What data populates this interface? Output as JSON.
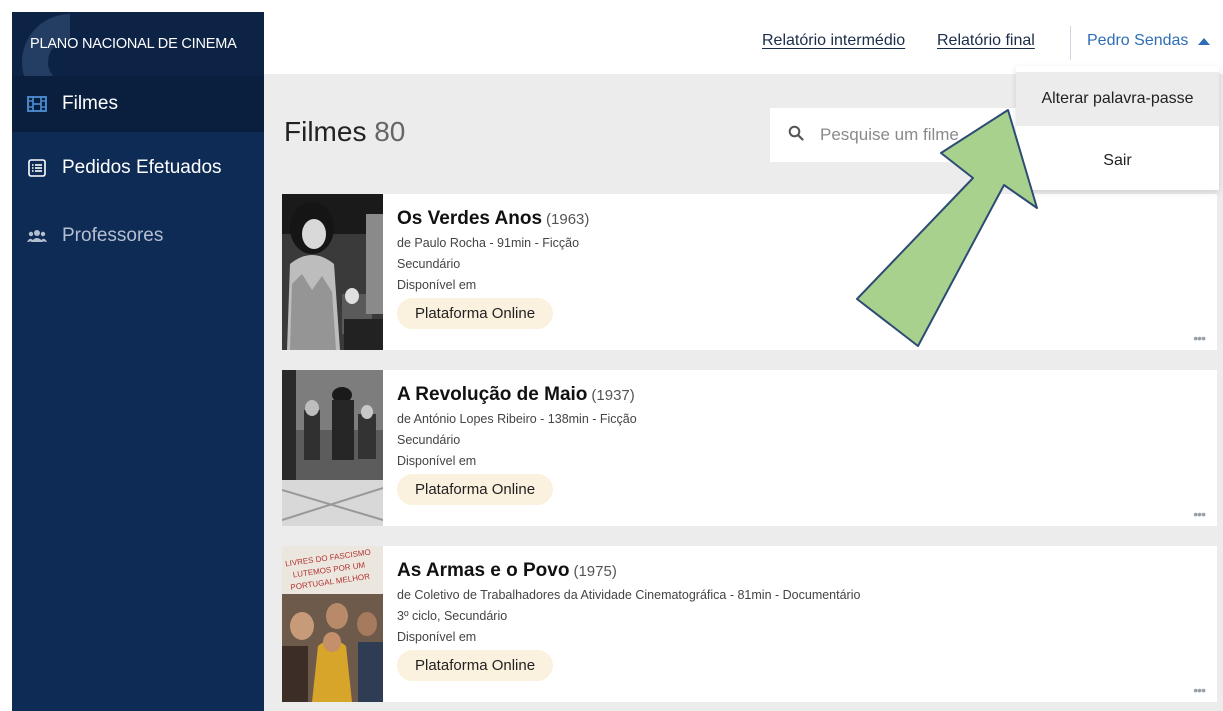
{
  "brand": {
    "logo_text": "PLANO NACIONAL DE CINEMA"
  },
  "sidebar": {
    "items": [
      {
        "label": "Filmes",
        "icon": "film-icon",
        "active": true
      },
      {
        "label": "Pedidos Efetuados",
        "icon": "list-icon",
        "active": false
      },
      {
        "label": "Professores",
        "icon": "users-icon",
        "active": false
      }
    ]
  },
  "topbar": {
    "link_intermediate": "Relatório intermédio",
    "link_final": "Relatório final",
    "user_name": "Pedro Sendas"
  },
  "user_dropdown": {
    "items": [
      "Alterar palavra-passe",
      "Sair"
    ]
  },
  "main": {
    "title": "Filmes",
    "count": "80",
    "search_placeholder": "Pesquise um filme"
  },
  "films": [
    {
      "title": "Os Verdes Anos",
      "year": "(1963)",
      "meta": "de Paulo Rocha - 91min - Ficção",
      "level": "Secundário",
      "available_label": "Disponível em",
      "platform": "Plataforma Online"
    },
    {
      "title": "A Revolução de Maio",
      "year": "(1937)",
      "meta": "de António Lopes Ribeiro - 138min - Ficção",
      "level": "Secundário",
      "available_label": "Disponível em",
      "platform": "Plataforma Online"
    },
    {
      "title": "As Armas e o Povo",
      "year": "(1975)",
      "meta": "de Coletivo de Trabalhadores da Atividade Cinematográfica - 81min - Documentário",
      "level": "3º ciclo, Secundário",
      "available_label": "Disponível em",
      "platform": "Plataforma Online",
      "poster_text": "LIVRES DO FASCISMO LUTEMOS POR UM PORTUGAL MELHOR"
    }
  ],
  "more_label": "•••",
  "colors": {
    "sidebar_bg": "#0e2b55",
    "user_link": "#2f6db5",
    "pill_bg": "#fbf1df",
    "arrow_fill": "#a9d18e",
    "arrow_stroke": "#2e4b74"
  }
}
